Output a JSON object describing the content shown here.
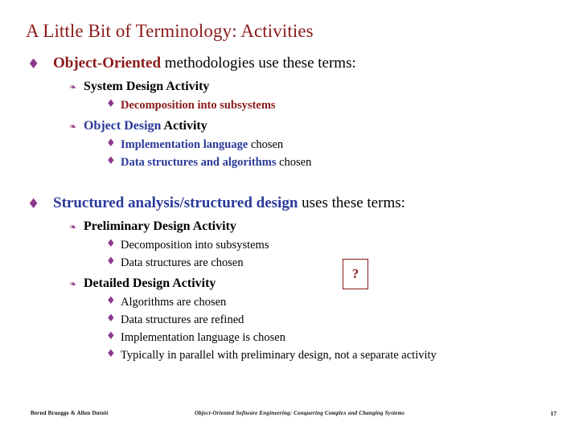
{
  "slide": {
    "title": "A Little Bit of Terminology: Activities",
    "bullets": {
      "b1_pre": "Object-Oriented",
      "b1_post": " methodologies use these terms:",
      "b1_sub1": "System Design Activity",
      "b1_sub1_item1": "Decomposition into subsystems",
      "b1_sub2_pre": "Object Design",
      "b1_sub2_post": " Activity",
      "b1_sub2_item1_a": "Implementation language",
      "b1_sub2_item1_b": " chosen",
      "b1_sub2_item2_a": "Data structures and algorithms",
      "b1_sub2_item2_b": " chosen",
      "b2_pre": "Structured analysis/structured design",
      "b2_post": " uses these terms:",
      "b2_sub1": "Preliminary Design Activity",
      "b2_sub1_item1": "Decomposition into subsystems",
      "b2_sub1_item2": "Data structures are chosen",
      "b2_sub2": "Detailed Design Activity",
      "b2_sub2_item1": "Algorithms are chosen",
      "b2_sub2_item2": "Data structures are refined",
      "b2_sub2_item3": "Implementation language is chosen",
      "b2_sub2_item4": "Typically in parallel with preliminary design, not a separate activity"
    },
    "callout": "?",
    "footer": {
      "left": "Bernd Bruegge & Allen Dutoit",
      "center": "Object-Oriented Software Engineering: Conquering Complex and Changing Systems",
      "right": "17"
    },
    "glyphs": {
      "level1_bullet": "♦",
      "level2_bullet": "❧",
      "level3_bullet": "♦"
    },
    "colors": {
      "title": "#8b1a1a",
      "bullet": "#8b3a8b",
      "keyword_maroon": "#8b1a1a",
      "keyword_blue": "#2a3a9a"
    }
  }
}
